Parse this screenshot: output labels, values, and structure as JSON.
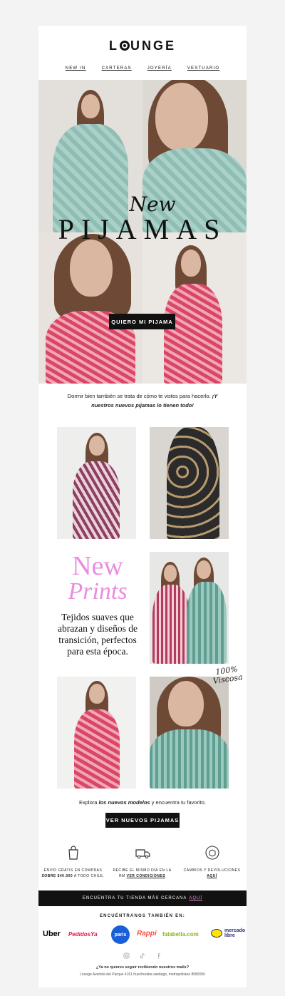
{
  "brand": {
    "logo_pre": "L",
    "logo_post": "UNGE"
  },
  "nav": [
    "NEW IN",
    "CARTERAS",
    "JOYERÍA",
    "VESTUARIO"
  ],
  "hero": {
    "title_small": "New",
    "title_big": "PIJAMAS",
    "button": "QUIERO MI PIJAMA"
  },
  "intro": {
    "text_a": "Dormir bien también se trata de cómo te vistes para hacerlo. ",
    "text_b": "¡Y nuestros nuevos pijamas lo tienen todo!"
  },
  "prints": {
    "new": "New",
    "prints": "Prints",
    "body": "Tejidos suaves que abrazan y diseños de transición, perfectos para esta época."
  },
  "viscosa": {
    "line1": "100%",
    "line2": "Viscosa"
  },
  "explore": {
    "pre": "Explora ",
    "bold": "los nuevos modelos",
    "post": " y encuentra tu favorito."
  },
  "cta": "VER NUEVOS PIJAMAS",
  "benefits": [
    {
      "line1": "ENVÍO GRATIS EN COMPRAS",
      "line2a": "SOBRE $40.000",
      "line2b": " A TODO CHILE."
    },
    {
      "line1": "RECIBE EL MISMO DÍA EN LA",
      "line2a": "RM ",
      "line2b": "VER CONDICIONES"
    },
    {
      "line1": "CAMBIOS Y DEVOLUCIONES",
      "line2a": "",
      "line2b": "AQUÍ"
    }
  ],
  "store": {
    "text": "ENCUENTRA TU TIENDA MÁS CERCANA",
    "link": "AQUÍ"
  },
  "found": "ENCUÉNTRANOS TAMBIÉN EN:",
  "partners": [
    "Uber",
    "PedidosYa",
    "paris",
    "Rappi",
    "falabella.com",
    "mercado libre"
  ],
  "footer": {
    "line1": "¿Ya no quieres seguir recibiendo nuestros mails?",
    "line2": "Lounge Avenida del Parque 4161 huechuraba santiago, metropolitana 8580000"
  },
  "colors": {
    "accent_pink": "#ec8cde",
    "dark": "#111111",
    "background": "#f3f3f3"
  }
}
